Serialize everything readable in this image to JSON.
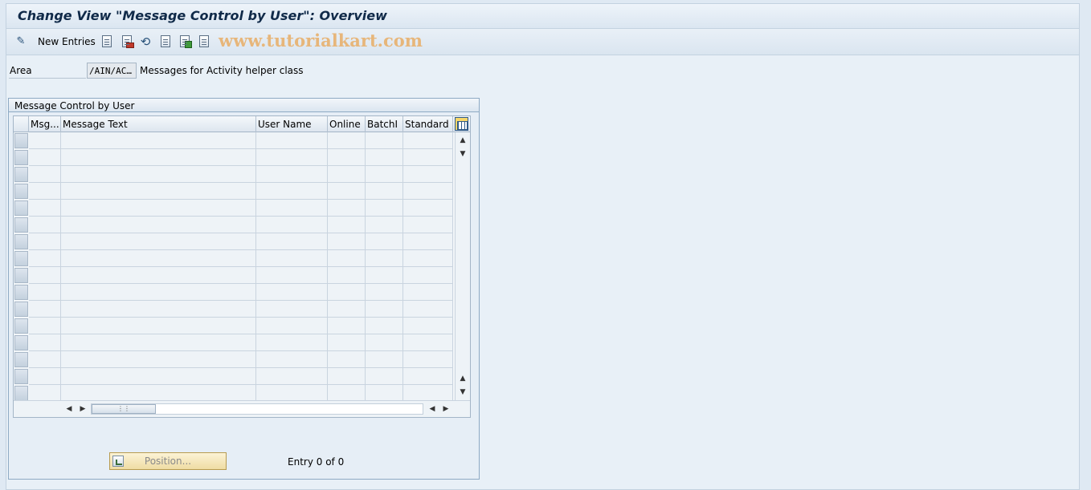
{
  "window": {
    "title": "Change View \"Message Control by User\": Overview"
  },
  "toolbar": {
    "new_entries_label": "New Entries",
    "watermark": "www.tutorialkart.com",
    "icons": [
      "edit-pencil-icon",
      "copy-icon",
      "delete-icon",
      "undo-icon",
      "select-all-icon",
      "select-block-icon",
      "deselect-all-icon"
    ]
  },
  "area": {
    "label": "Area",
    "value": "/AIN/AC…",
    "description": "Messages for Activity helper class"
  },
  "table_group": {
    "title": "Message Control by User",
    "columns": [
      "Msg...",
      "Message Text",
      "User Name",
      "Online",
      "BatchI",
      "Standard"
    ],
    "rows": []
  },
  "footer": {
    "position_button_label": "Position...",
    "entry_info": "Entry 0 of 0"
  }
}
